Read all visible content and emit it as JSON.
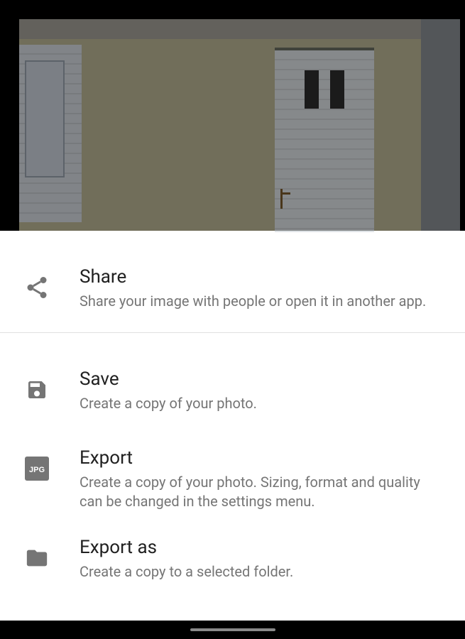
{
  "options": {
    "share": {
      "title": "Share",
      "desc": "Share your image with people or open it in another app."
    },
    "save": {
      "title": "Save",
      "desc": "Create a copy of your photo."
    },
    "export": {
      "title": "Export",
      "desc": "Create a copy of your photo. Sizing, format and quality can be changed in the settings menu."
    },
    "export_as": {
      "title": "Export as",
      "desc": "Create a copy to a selected folder."
    }
  },
  "export_badge": "JPG"
}
